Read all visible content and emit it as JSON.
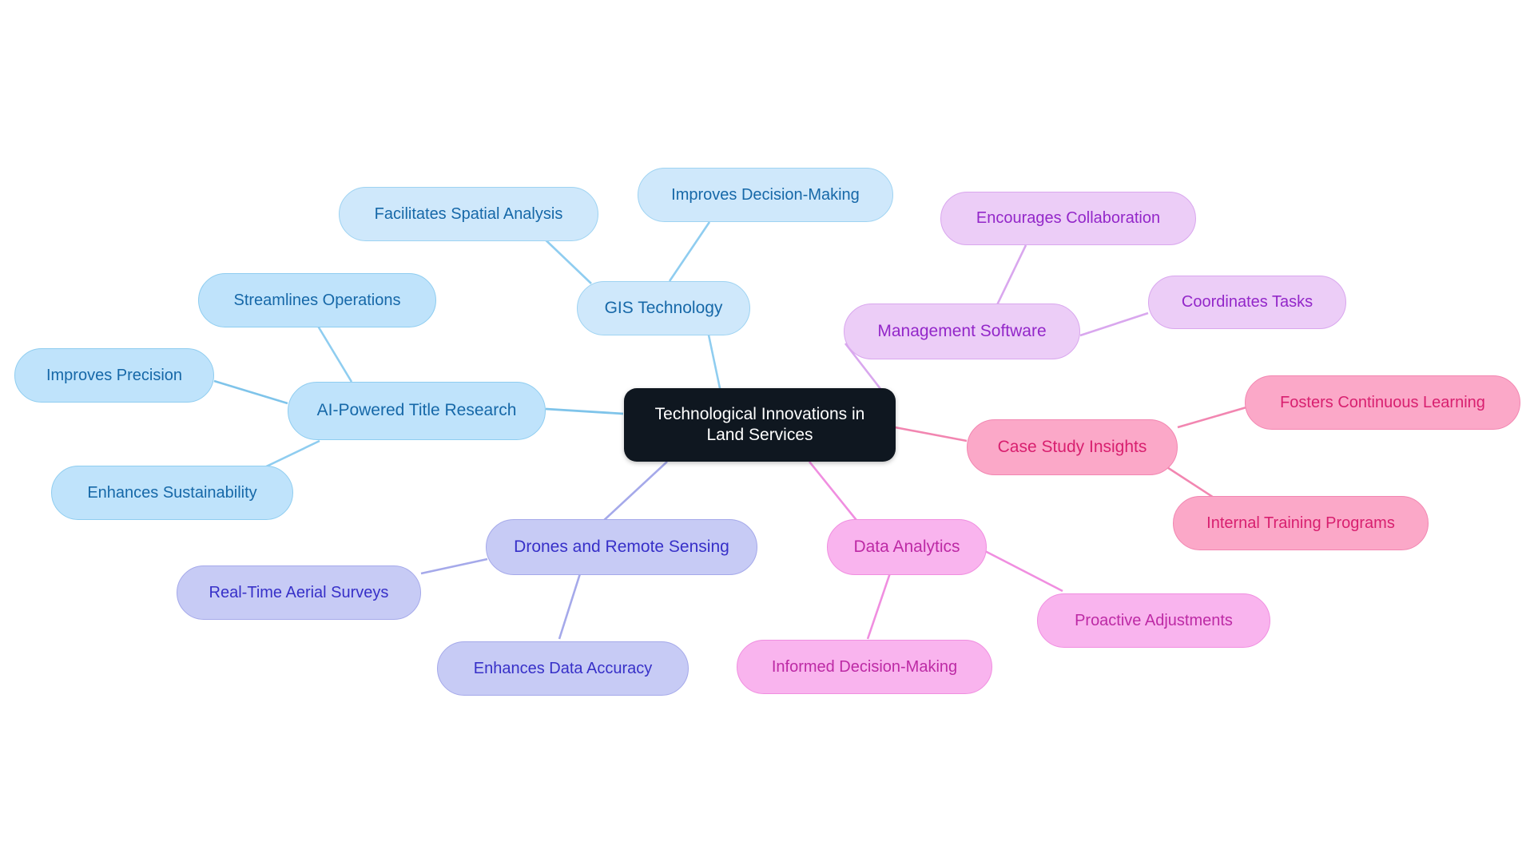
{
  "diagram": {
    "kind": "mind-map",
    "title": "Technological Innovations in Land Services",
    "background_color": "#ffffff"
  },
  "palette": {
    "root_fill": "#0f1720",
    "root_text": "#ffffff",
    "sky_fill": "#bfe3fb",
    "sky_text": "#1668a8",
    "sky_border": "#8fcdf0",
    "periwinkle_fill": "#c7cbf5",
    "periwinkle_text": "#3730c8",
    "periwinkle_border": "#a5a9ea",
    "lavender_fill": "#eccdf7",
    "lavender_text": "#9327c9",
    "lavender_border": "#d9a7ee",
    "orchid_fill": "#f9b4ee",
    "orchid_text": "#bd2aa5",
    "orchid_border": "#f08ee0",
    "rose_fill": "#fba8c8",
    "rose_text": "#d81f6f",
    "rose_border": "#f286b1"
  },
  "chart_data": {
    "type": "mindmap",
    "title": "Technological Innovations in Land Services",
    "root": "Technological Innovations in Land Services",
    "branches": [
      {
        "name": "AI-Powered Title Research",
        "color_key": "sky",
        "children": [
          "Improves Precision",
          "Streamlines Operations",
          "Enhances Sustainability"
        ]
      },
      {
        "name": "GIS Technology",
        "color_key": "sky",
        "children": [
          "Facilitates Spatial Analysis",
          "Improves Decision-Making"
        ]
      },
      {
        "name": "Management Software",
        "color_key": "lavender",
        "children": [
          "Encourages Collaboration",
          "Coordinates Tasks"
        ]
      },
      {
        "name": "Case Study Insights",
        "color_key": "rose",
        "children": [
          "Fosters Continuous Learning",
          "Internal Training Programs"
        ]
      },
      {
        "name": "Data Analytics",
        "color_key": "orchid",
        "children": [
          "Informed Decision-Making",
          "Proactive Adjustments"
        ]
      },
      {
        "name": "Drones and Remote Sensing",
        "color_key": "periwinkle",
        "children": [
          "Real-Time Aerial Surveys",
          "Enhances Data Accuracy"
        ]
      }
    ]
  },
  "nodes": {
    "root": {
      "label": "Technological Innovations in\nLand Services"
    },
    "ai_title_research": {
      "label": "AI-Powered Title Research"
    },
    "improves_precision": {
      "label": "Improves Precision"
    },
    "streamlines_operations": {
      "label": "Streamlines Operations"
    },
    "enhances_sustainability": {
      "label": "Enhances Sustainability"
    },
    "gis_technology": {
      "label": "GIS Technology"
    },
    "facilitates_spatial_analysis": {
      "label": "Facilitates Spatial Analysis"
    },
    "improves_decision_making": {
      "label": "Improves Decision-Making"
    },
    "management_software": {
      "label": "Management Software"
    },
    "encourages_collaboration": {
      "label": "Encourages Collaboration"
    },
    "coordinates_tasks": {
      "label": "Coordinates Tasks"
    },
    "case_study_insights": {
      "label": "Case Study Insights"
    },
    "fosters_continuous_learning": {
      "label": "Fosters Continuous Learning"
    },
    "internal_training_programs": {
      "label": "Internal Training Programs"
    },
    "data_analytics": {
      "label": "Data Analytics"
    },
    "informed_decision_making": {
      "label": "Informed Decision-Making"
    },
    "proactive_adjustments": {
      "label": "Proactive Adjustments"
    },
    "drones_remote_sensing": {
      "label": "Drones and Remote Sensing"
    },
    "real_time_aerial_surveys": {
      "label": "Real-Time Aerial Surveys"
    },
    "enhances_data_accuracy": {
      "label": "Enhances Data Accuracy"
    }
  }
}
